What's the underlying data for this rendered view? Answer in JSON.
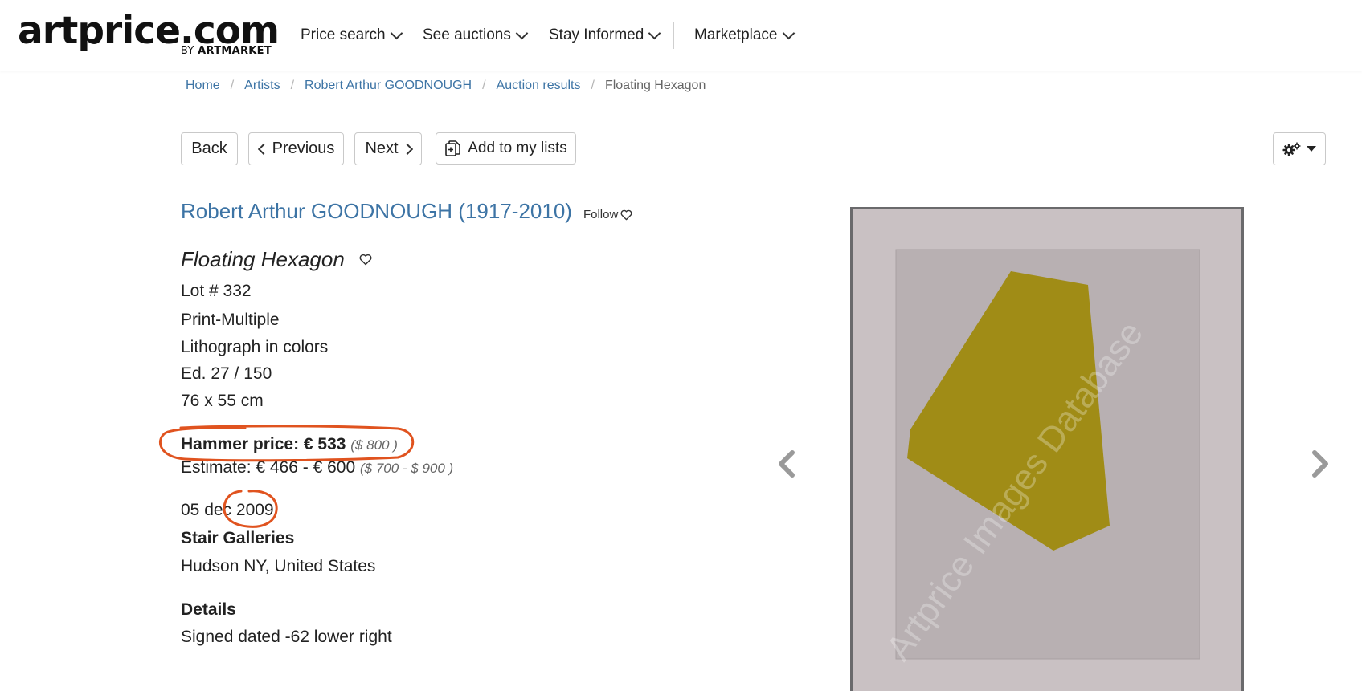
{
  "header": {
    "logo_main": "artprice.com",
    "logo_by": "BY",
    "logo_brand": "ARTMARKET",
    "nav": [
      {
        "label": "Price search"
      },
      {
        "label": "See auctions"
      },
      {
        "label": "Stay Informed"
      },
      {
        "label": "Marketplace"
      }
    ]
  },
  "breadcrumb": [
    {
      "label": "Home"
    },
    {
      "label": "Artists"
    },
    {
      "label": "Robert Arthur GOODNOUGH"
    },
    {
      "label": "Auction results"
    },
    {
      "label": "Floating Hexagon"
    }
  ],
  "toolbar": {
    "back_label": "Back",
    "previous_label": "Previous",
    "next_label": "Next",
    "add_to_lists_label": "Add to my lists",
    "settings_icon": "gears-icon"
  },
  "lot": {
    "artist": "Robert Arthur GOODNOUGH (1917-2010)",
    "follow_label": "Follow",
    "title": "Floating Hexagon",
    "lot_number": "Lot # 332",
    "category": "Print-Multiple",
    "medium": "Lithograph in colors",
    "edition": "Ed. 27 / 150",
    "dimensions": "76 x 55 cm",
    "hammer_label": "Hammer price: € 533",
    "hammer_usd": "($ 800 )",
    "estimate_label": "Estimate: € 466 - € 600",
    "estimate_usd": "($ 700 - $ 900 )",
    "date": "05 dec 2009",
    "auction_house": "Stair Galleries",
    "location": "Hudson NY, United States",
    "details_heading": "Details",
    "details_text": "Signed dated -62 lower right"
  },
  "image": {
    "watermark": "Artprice Images Database",
    "shape_color": "#a08c16",
    "paper_color": "#b8b0b2",
    "mat_color": "#c9c1c3"
  },
  "colors": {
    "link": "#3d74a5",
    "annotation": "#e0531f"
  }
}
